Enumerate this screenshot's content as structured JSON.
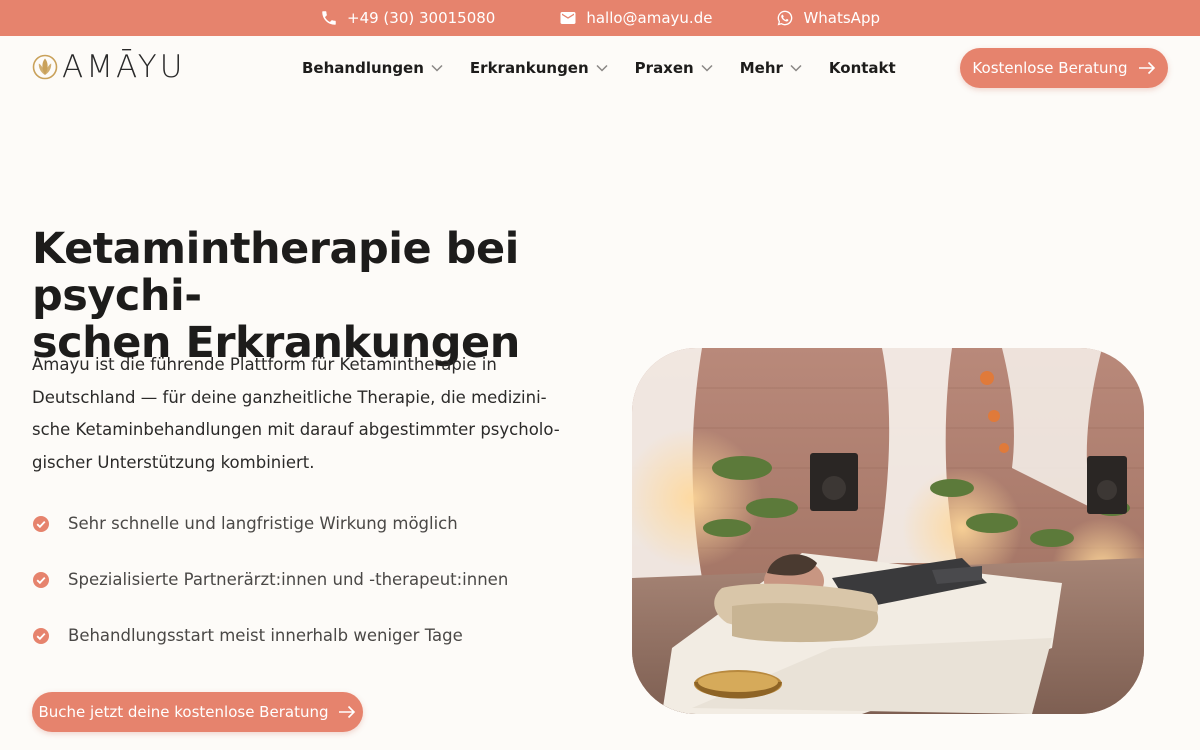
{
  "topbar": {
    "phone": "+49 (30) 30015080",
    "email": "hallo@amayu.de",
    "whatsapp": "WhatsApp",
    "icons": [
      "phone-icon",
      "mail-icon",
      "whatsapp-icon"
    ]
  },
  "header": {
    "logo_text": "AMĀYU",
    "nav": [
      {
        "label": "Behandlungen",
        "has_dropdown": true
      },
      {
        "label": "Erkrankungen",
        "has_dropdown": true
      },
      {
        "label": "Praxen",
        "has_dropdown": true
      },
      {
        "label": "Mehr",
        "has_dropdown": true
      },
      {
        "label": "Kontakt",
        "has_dropdown": false
      }
    ],
    "cta_label": "Kostenlose Beratung"
  },
  "hero": {
    "title_lines": [
      "Ketamintherapie bei psychi-",
      "schen Erkrankungen"
    ],
    "description_lines": [
      "Amayu ist die führende Plattform für Ketamintherapie in",
      "Deutschland — für deine ganzheitliche Therapie, die medizini-",
      "sche Ketaminbehandlungen mit darauf abgestimmter psycholo-",
      "gischer Unterstützung kombiniert."
    ],
    "features": [
      "Sehr schnelle und langfristige Wirkung möglich",
      "Spezialisierte Partnerärzt:innen und -therapeut:innen",
      "Behandlungsstart meist innerhalb weniger Tage"
    ],
    "cta_label": "Buche jetzt deine kostenlose Beratung"
  },
  "colors": {
    "accent": "#e6836d",
    "background": "#fdfbf8",
    "text": "#1d1c1b",
    "logo_gold": "#c9a15a"
  }
}
